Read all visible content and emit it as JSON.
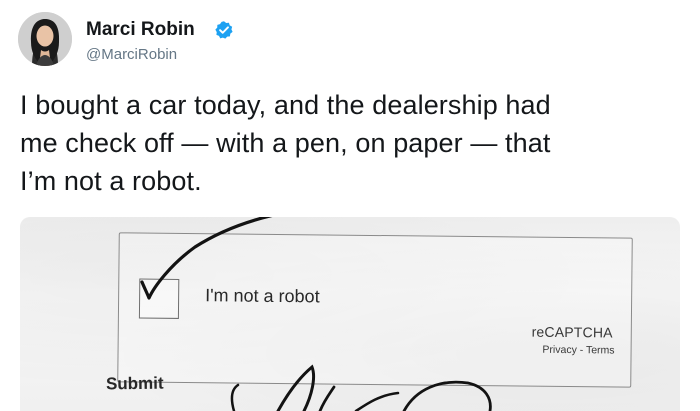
{
  "author": {
    "display_name": "Marci Robin",
    "handle": "@MarciRobin",
    "avatar_icon": "avatar-photo",
    "verified_icon": "verified-badge-icon",
    "verified_color": "#1da1f2"
  },
  "tweet": {
    "lines": [
      "I bought a car today, and the dealership had",
      "me check off — with a pen, on paper — that",
      "I’m not a robot."
    ]
  },
  "photo": {
    "checkbox_label": "I'm not a robot",
    "recaptcha_brand": "reCAPTCHA",
    "recaptcha_links": "Privacy - Terms",
    "submit_label": "Submit",
    "checkmark": "handwritten-checkmark",
    "signature": "handwritten-signature"
  }
}
